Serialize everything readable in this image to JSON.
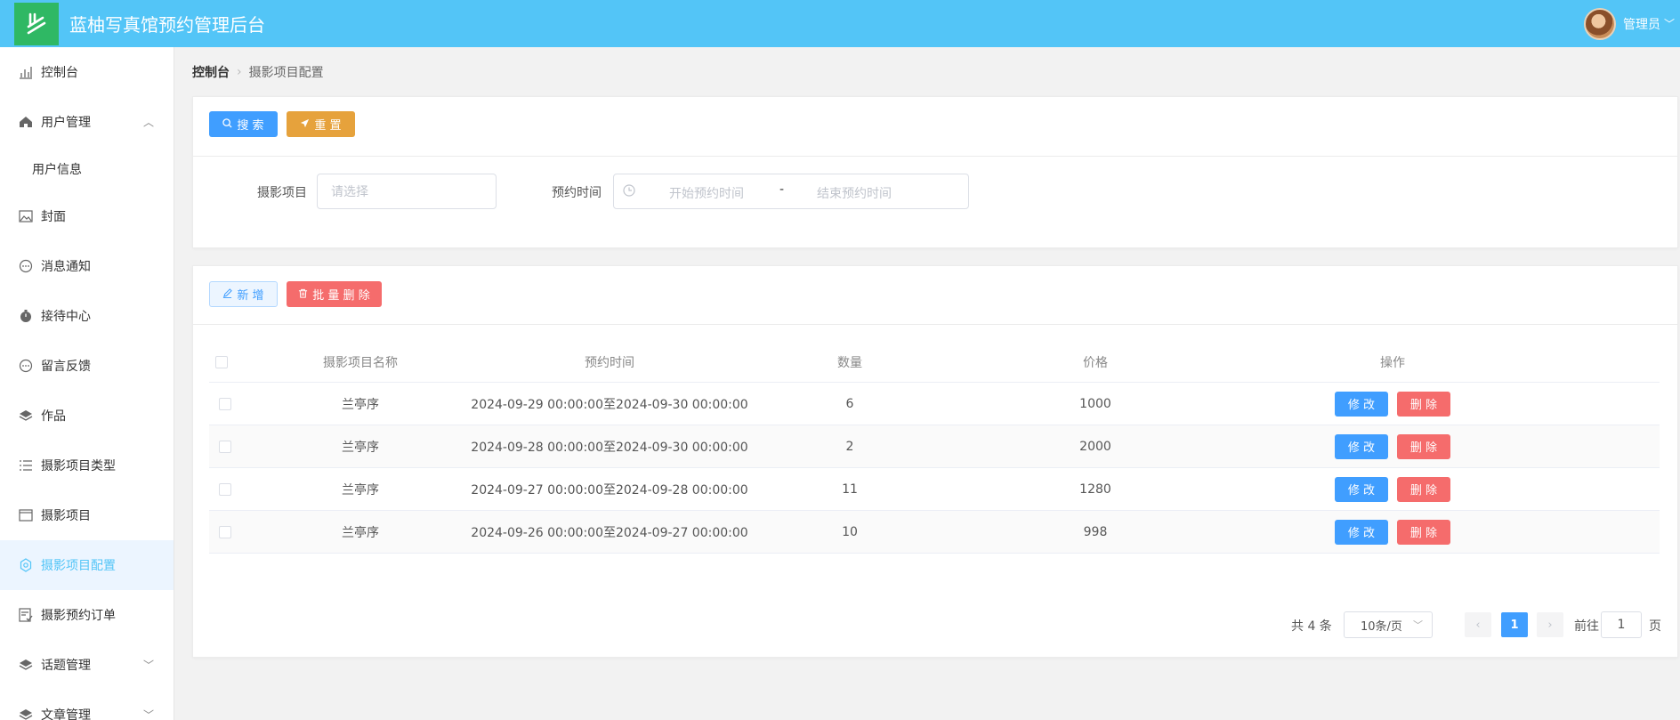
{
  "header": {
    "title": "蓝柚写真馆预约管理后台",
    "user_name": "管理员",
    "colors": {
      "bar": "#53c5f7",
      "logo": "#2fb864"
    }
  },
  "sidebar": {
    "items": [
      {
        "label": "控制台",
        "icon": "chart-icon"
      },
      {
        "label": "用户管理",
        "icon": "home-icon",
        "arrow": "up"
      },
      {
        "label": "用户信息",
        "sub": true
      },
      {
        "label": "封面",
        "icon": "image-icon"
      },
      {
        "label": "消息通知",
        "icon": "chat-icon"
      },
      {
        "label": "接待中心",
        "icon": "stopwatch-icon"
      },
      {
        "label": "留言反馈",
        "icon": "chat-icon"
      },
      {
        "label": "作品",
        "icon": "layers-icon"
      },
      {
        "label": "摄影项目类型",
        "icon": "list-icon"
      },
      {
        "label": "摄影项目",
        "icon": "window-icon"
      },
      {
        "label": "摄影项目配置",
        "icon": "gear-icon",
        "active": true
      },
      {
        "label": "摄影预约订单",
        "icon": "order-icon"
      },
      {
        "label": "话题管理",
        "icon": "layers-icon",
        "arrow": "down"
      },
      {
        "label": "文章管理",
        "icon": "layers-icon",
        "arrow": "down"
      }
    ]
  },
  "breadcrumb": {
    "home": "控制台",
    "current": "摄影项目配置"
  },
  "search": {
    "search_label": "搜 索",
    "reset_label": "重 置",
    "project_label": "摄影项目",
    "project_placeholder": "请选择",
    "time_label": "预约时间",
    "start_placeholder": "开始预约时间",
    "range_sep": "-",
    "end_placeholder": "结束预约时间"
  },
  "toolbar": {
    "add_label": "新 增",
    "batch_delete_label": "批 量 删 除"
  },
  "table": {
    "columns": [
      "摄影项目名称",
      "预约时间",
      "数量",
      "价格",
      "操作"
    ],
    "edit_label": "修 改",
    "delete_label": "删 除",
    "rows": [
      {
        "name": "兰亭序",
        "time": "2024-09-29 00:00:00至2024-09-30 00:00:00",
        "qty": "6",
        "price": "1000"
      },
      {
        "name": "兰亭序",
        "time": "2024-09-28 00:00:00至2024-09-30 00:00:00",
        "qty": "2",
        "price": "2000"
      },
      {
        "name": "兰亭序",
        "time": "2024-09-27 00:00:00至2024-09-28 00:00:00",
        "qty": "11",
        "price": "1280"
      },
      {
        "name": "兰亭序",
        "time": "2024-09-26 00:00:00至2024-09-27 00:00:00",
        "qty": "10",
        "price": "998"
      }
    ]
  },
  "pagination": {
    "total": "共 4 条",
    "page_size": "10条/页",
    "current_page": "1",
    "goto_label": "前往",
    "goto_value": "1",
    "page_suffix": "页"
  }
}
